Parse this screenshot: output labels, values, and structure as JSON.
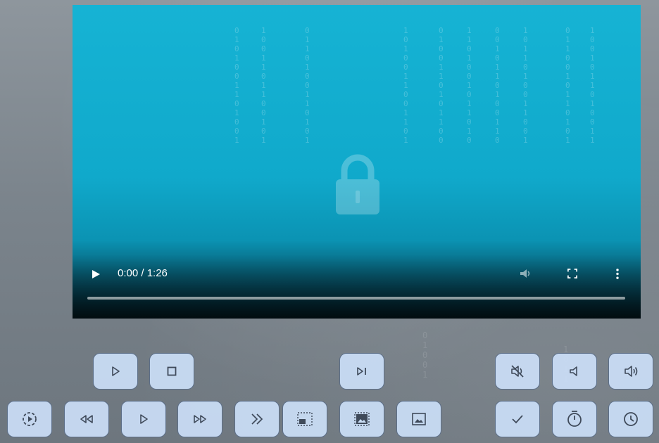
{
  "player": {
    "current_time": "0:00",
    "duration": "1:26",
    "time_display": "0:00 / 1:26",
    "progress": 0,
    "accent_color": "#10a9cb"
  },
  "buttons": {
    "row1": [
      {
        "name": "play-button",
        "icon": "play-icon"
      },
      {
        "name": "stop-button",
        "icon": "stop-icon"
      },
      {
        "name": "next-frame-button",
        "icon": "skip-next-icon"
      },
      {
        "name": "mute-button",
        "icon": "volume-off-icon"
      },
      {
        "name": "volume-down-button",
        "icon": "volume-low-icon"
      },
      {
        "name": "volume-up-button",
        "icon": "volume-high-icon"
      }
    ],
    "row2": [
      {
        "name": "autoplay-button",
        "icon": "play-circle-dashed-icon"
      },
      {
        "name": "rewind-button",
        "icon": "rewind-icon"
      },
      {
        "name": "play-button-2",
        "icon": "play-icon"
      },
      {
        "name": "fast-forward-button",
        "icon": "fast-forward-icon"
      },
      {
        "name": "skip-forward-button",
        "icon": "double-chevron-right-icon"
      },
      {
        "name": "picture-in-picture-button",
        "icon": "pip-icon"
      },
      {
        "name": "fullscreen-image-button",
        "icon": "image-frame-icon"
      },
      {
        "name": "poster-image-button",
        "icon": "image-icon"
      },
      {
        "name": "confirm-button",
        "icon": "check-icon"
      },
      {
        "name": "timer-button",
        "icon": "timer-icon"
      },
      {
        "name": "clock-button",
        "icon": "clock-icon"
      }
    ]
  }
}
